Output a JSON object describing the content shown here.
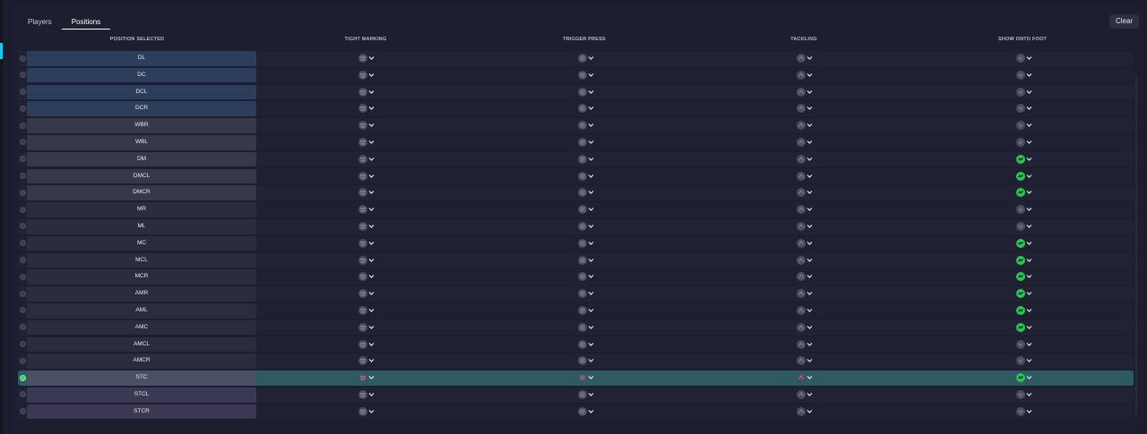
{
  "tabs": [
    {
      "label": "Players",
      "active": false
    },
    {
      "label": "Positions",
      "active": true
    }
  ],
  "clear_label": "Clear",
  "columns": {
    "position": "POSITION SELECTED",
    "tight_marking": "TIGHT MARKING",
    "trigger_press": "TRIGGER PRESS",
    "tackling": "TACKLING",
    "show_onto_foot": "SHOW ONTO FOOT"
  },
  "colors": {
    "accent": "#27c3e8",
    "selected_row": "#2f5a62",
    "active_icon": "#2fc25b"
  },
  "icons": {
    "tight_marking": "tight-marking-icon",
    "trigger_press": "trigger-press-icon",
    "tackling": "tackling-icon",
    "show_onto_foot": "show-onto-foot-icon"
  },
  "rows": [
    {
      "pos": "DL",
      "tone": "blue",
      "foot_on": false,
      "selected": false
    },
    {
      "pos": "DC",
      "tone": "blue",
      "foot_on": false,
      "selected": false
    },
    {
      "pos": "DCL",
      "tone": "blue",
      "foot_on": false,
      "selected": false
    },
    {
      "pos": "DCR",
      "tone": "blue",
      "foot_on": false,
      "selected": false
    },
    {
      "pos": "WBR",
      "tone": "grey",
      "foot_on": false,
      "selected": false
    },
    {
      "pos": "WBL",
      "tone": "grey",
      "foot_on": false,
      "selected": false
    },
    {
      "pos": "DM",
      "tone": "grey",
      "foot_on": true,
      "selected": false
    },
    {
      "pos": "DMCL",
      "tone": "grey",
      "foot_on": true,
      "selected": false
    },
    {
      "pos": "DMCR",
      "tone": "grey",
      "foot_on": true,
      "selected": false
    },
    {
      "pos": "MR",
      "tone": "dark",
      "foot_on": false,
      "selected": false
    },
    {
      "pos": "ML",
      "tone": "dark",
      "foot_on": false,
      "selected": false
    },
    {
      "pos": "MC",
      "tone": "dark",
      "foot_on": true,
      "selected": false
    },
    {
      "pos": "MCL",
      "tone": "dark",
      "foot_on": true,
      "selected": false
    },
    {
      "pos": "MCR",
      "tone": "dark",
      "foot_on": true,
      "selected": false
    },
    {
      "pos": "AMR",
      "tone": "dark",
      "foot_on": true,
      "selected": false
    },
    {
      "pos": "AML",
      "tone": "dark",
      "foot_on": true,
      "selected": false
    },
    {
      "pos": "AMC",
      "tone": "dark",
      "foot_on": true,
      "selected": false
    },
    {
      "pos": "AMCL",
      "tone": "dark",
      "foot_on": false,
      "selected": false
    },
    {
      "pos": "AMCR",
      "tone": "dark",
      "foot_on": false,
      "selected": false
    },
    {
      "pos": "STC",
      "tone": "sel",
      "foot_on": true,
      "selected": true
    },
    {
      "pos": "STCL",
      "tone": "purple",
      "foot_on": false,
      "selected": false
    },
    {
      "pos": "STCR",
      "tone": "purple",
      "foot_on": false,
      "selected": false
    }
  ]
}
